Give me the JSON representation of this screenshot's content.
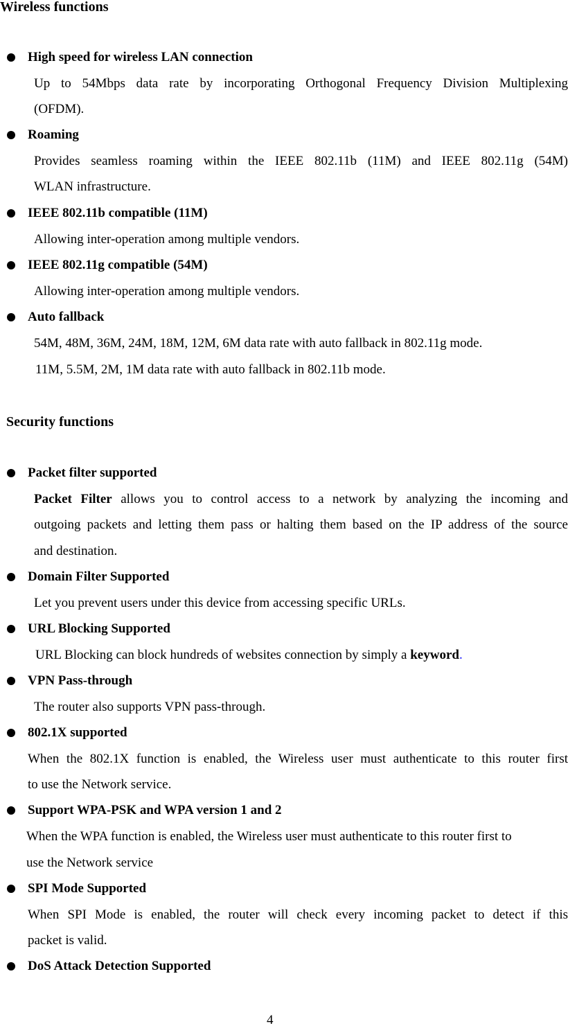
{
  "wireless": {
    "title": "Wireless functions",
    "items": [
      {
        "title": "High speed for wireless LAN connection",
        "lines": [
          "Up to 54Mbps data rate by incorporating Orthogonal Frequency Division Multiplexing",
          "(OFDM)."
        ]
      },
      {
        "title": "Roaming",
        "lines": [
          "Provides seamless roaming within the IEEE 802.11b (11M) and IEEE 802.11g (54M)",
          "WLAN infrastructure."
        ]
      },
      {
        "title": "IEEE 802.11b compatible (11M)",
        "lines": [
          "Allowing inter-operation among multiple vendors."
        ]
      },
      {
        "title": "IEEE 802.11g compatible (54M)",
        "lines": [
          "Allowing inter-operation among multiple vendors."
        ]
      },
      {
        "title": "Auto fallback",
        "lines": [
          "54M, 48M, 36M, 24M, 18M, 12M, 6M data rate with auto fallback in 802.11g mode.",
          "11M, 5.5M, 2M, 1M data rate with auto fallback in 802.11b mode."
        ]
      }
    ]
  },
  "security": {
    "title": "Security functions",
    "items": [
      {
        "title": "Packet filter supported",
        "lead_bold": "Packet Filter",
        "lines": [
          " allows you to control access to a network by analyzing the incoming and",
          "outgoing packets and letting them pass or halting them based on the IP address of the source",
          "and destination."
        ]
      },
      {
        "title": "Domain Filter Supported",
        "lines": [
          "Let you prevent users under this device from accessing specific URLs."
        ]
      },
      {
        "title": "URL Blocking Supported",
        "line_prefix": "URL Blocking can block hundreds of websites connection by simply a ",
        "line_bold": "keyword",
        "line_suffix": "."
      },
      {
        "title": "VPN Pass-through",
        "lines": [
          "The router also supports VPN pass-through."
        ]
      },
      {
        "title": "802.1X supported",
        "lines": [
          "When the 802.1X function is enabled, the Wireless user must authenticate to this router first",
          "to use the Network service."
        ]
      },
      {
        "title": "Support WPA-PSK and WPA version 1 and 2",
        "lines": [
          "When the WPA function is enabled, the Wireless user must authenticate to this router first to",
          "use the Network service"
        ]
      },
      {
        "title": "SPI Mode Supported",
        "lines": [
          "When SPI Mode is enabled, the router will check every incoming packet to detect if this",
          "packet is valid."
        ]
      },
      {
        "title": "DoS Attack Detection Supported"
      }
    ]
  },
  "page_number": "4",
  "colors": {
    "text": "#000000",
    "accent_period": "#1a1aff"
  }
}
